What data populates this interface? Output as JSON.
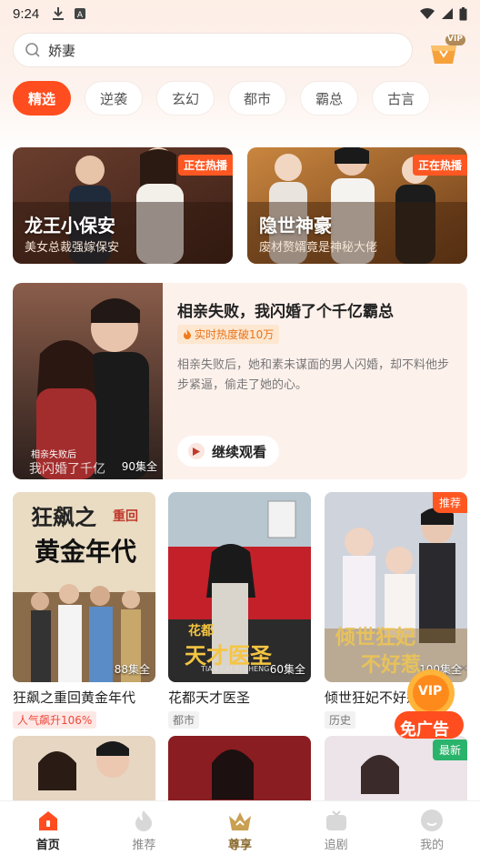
{
  "status_bar": {
    "time": "9:24"
  },
  "search": {
    "value": "娇妻"
  },
  "vip_label": "VIP",
  "tabs": [
    "精选",
    "逆袭",
    "玄幻",
    "都市",
    "霸总",
    "古言"
  ],
  "hot_cards": [
    {
      "badge": "正在热播",
      "title": "龙王小保安",
      "subtitle": "美女总裁强嫁保安"
    },
    {
      "badge": "正在热播",
      "title": "隐世神豪",
      "subtitle": "废材赘婿竟是神秘大佬"
    }
  ],
  "feature": {
    "title": "相亲失败，我闪婚了个千亿霸总",
    "heat": "实时热度破10万",
    "description": "相亲失败后，她和素未谋面的男人闪婚，却不料他步步紧逼，偷走了她的心。",
    "episodes": "90集全",
    "poster_text_1": "相亲失败后",
    "poster_text_2": "我闪婚了千亿",
    "continue_label": "继续观看"
  },
  "grid": [
    {
      "title": "狂飙之重回黄金年代",
      "episodes": "88集全",
      "tag": "人气飙升106%",
      "tag_type": "hot",
      "cover_text_1": "狂飙之",
      "cover_text_2": "重回",
      "cover_text_3": "黄金年代"
    },
    {
      "title": "花都天才医圣",
      "episodes": "60集全",
      "tag": "都市",
      "tag_type": "normal",
      "cover_text_1": "花都",
      "cover_text_2": "天才医圣",
      "cover_text_3": "TIAN CAI YI SHENG"
    },
    {
      "title": "倾世狂妃不好惹",
      "episodes": "100集全",
      "tag": "历史",
      "tag_type": "normal",
      "corner": "推荐",
      "cover_text_1": "倾世狂妃",
      "cover_text_2": "不好惹"
    }
  ],
  "second_row_corner": "最新",
  "ad": {
    "label": "免广告",
    "badge": "VIP"
  },
  "bottom_nav": [
    "首页",
    "推荐",
    "尊享",
    "追剧",
    "我的"
  ],
  "colors": {
    "accent": "#ff4d1f",
    "hot_badge": "#ff5722",
    "new_badge": "#2ab36b"
  }
}
